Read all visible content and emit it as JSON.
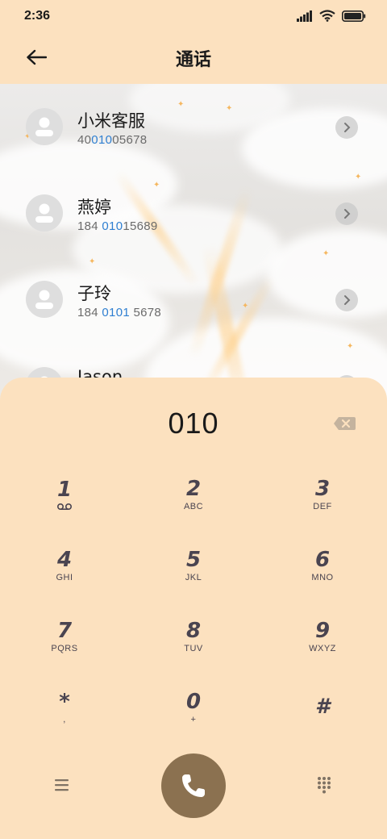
{
  "status": {
    "time": "2:36"
  },
  "header": {
    "title": "通话"
  },
  "contacts": [
    {
      "name": "小米客服",
      "num_before": "40",
      "num_match": "010",
      "num_after": "05678"
    },
    {
      "name": "燕婷",
      "num_before": "184 ",
      "num_match": "010",
      "num_after": "15689"
    },
    {
      "name": "子玲",
      "num_before": "184 ",
      "num_match": "0101",
      "num_after": " 5678"
    },
    {
      "name": "Jason",
      "num_before": "",
      "num_match": "",
      "num_after": ""
    }
  ],
  "dialpad": {
    "dialed": "010",
    "keys": [
      {
        "digit": "1",
        "letters": "voicemail-icon"
      },
      {
        "digit": "2",
        "letters": "ABC"
      },
      {
        "digit": "3",
        "letters": "DEF"
      },
      {
        "digit": "4",
        "letters": "GHI"
      },
      {
        "digit": "5",
        "letters": "JKL"
      },
      {
        "digit": "6",
        "letters": "MNO"
      },
      {
        "digit": "7",
        "letters": "PQRS"
      },
      {
        "digit": "8",
        "letters": "TUV"
      },
      {
        "digit": "9",
        "letters": "WXYZ"
      },
      {
        "digit": "*",
        "letters": ","
      },
      {
        "digit": "0",
        "letters": "+"
      },
      {
        "digit": "#",
        "letters": ""
      }
    ]
  },
  "colors": {
    "background": "#fce1bf",
    "call_button": "#8b7150",
    "highlight": "#2f7fd1"
  }
}
